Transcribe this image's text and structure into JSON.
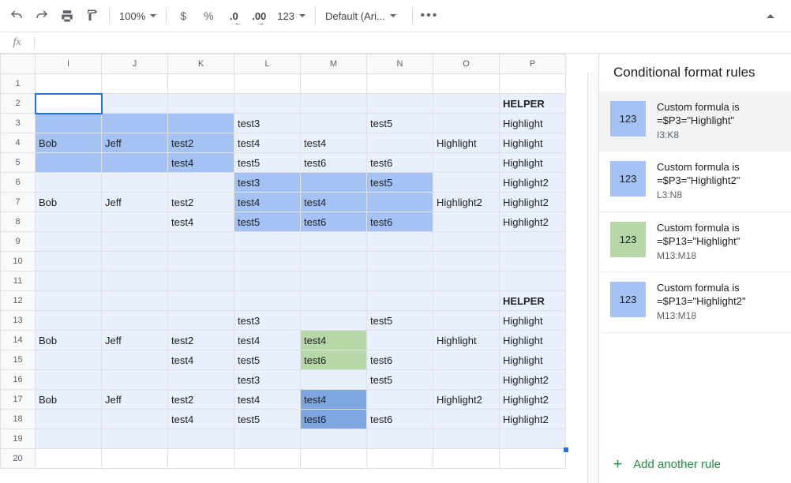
{
  "toolbar": {
    "zoom": "100%",
    "font": "Default (Ari...",
    "currency": "$",
    "percent": "%",
    "dec_less": ".0",
    "dec_more": ".00",
    "numfmt": "123"
  },
  "formula_bar": {
    "fx": "fx",
    "value": ""
  },
  "sheet": {
    "columns": [
      "I",
      "J",
      "K",
      "L",
      "M",
      "N",
      "O",
      "P"
    ],
    "rows": [
      1,
      2,
      3,
      4,
      5,
      6,
      7,
      8,
      9,
      10,
      11,
      12,
      13,
      14,
      15,
      16,
      17,
      18,
      19,
      20
    ],
    "cells": {
      "P2": "HELPER",
      "I4": "Bob",
      "J4": "Jeff",
      "K4": "test2",
      "O4": "Highlight",
      "K5": "test4",
      "L3": "test3",
      "L4": "test4",
      "L5": "test5",
      "M4": "test4",
      "M5": "test6",
      "N3": "test5",
      "N5": "test6",
      "P3": "Highlight",
      "P4": "Highlight",
      "P5": "Highlight",
      "I7": "Bob",
      "J7": "Jeff",
      "K7": "test2",
      "O7": "Highlight2",
      "K8": "test4",
      "L6": "test3",
      "L7": "test4",
      "L8": "test5",
      "M7": "test4",
      "M8": "test6",
      "N6": "test5",
      "N8": "test6",
      "P6": "Highlight2",
      "P7": "Highlight2",
      "P8": "Highlight2",
      "P12": "HELPER",
      "I14": "Bob",
      "J14": "Jeff",
      "K14": "test2",
      "O14": "Highlight",
      "K15": "test4",
      "L13": "test3",
      "L14": "test4",
      "L15": "test5",
      "M14": "test4",
      "M15": "test6",
      "N13": "test5",
      "N15": "test6",
      "P13": "Highlight",
      "P14": "Highlight",
      "P15": "Highlight",
      "I17": "Bob",
      "J17": "Jeff",
      "K17": "test2",
      "O17": "Highlight2",
      "K18": "test4",
      "L16": "test3",
      "L17": "test4",
      "L18": "test5",
      "M17": "test4",
      "M18": "test6",
      "N16": "test5",
      "N18": "test6",
      "P16": "Highlight2",
      "P17": "Highlight2",
      "P18": "Highlight2"
    }
  },
  "panel": {
    "title": "Conditional format rules",
    "swatch_label": "123",
    "rules": [
      {
        "line1": "Custom formula is",
        "line2": "=$P3=\"Highlight\"",
        "range": "I3:K8",
        "color": "#a4c2f4"
      },
      {
        "line1": "Custom formula is",
        "line2": "=$P3=\"Highlight2\"",
        "range": "L3:N8",
        "color": "#a4c2f4"
      },
      {
        "line1": "Custom formula is",
        "line2": "=$P13=\"Highlight\"",
        "range": "M13:M18",
        "color": "#b6d7a8"
      },
      {
        "line1": "Custom formula is",
        "line2": "=$P13=\"Highlight2\"",
        "range": "M13:M18",
        "color": "#a4c2f4"
      }
    ],
    "add": "Add another rule"
  }
}
